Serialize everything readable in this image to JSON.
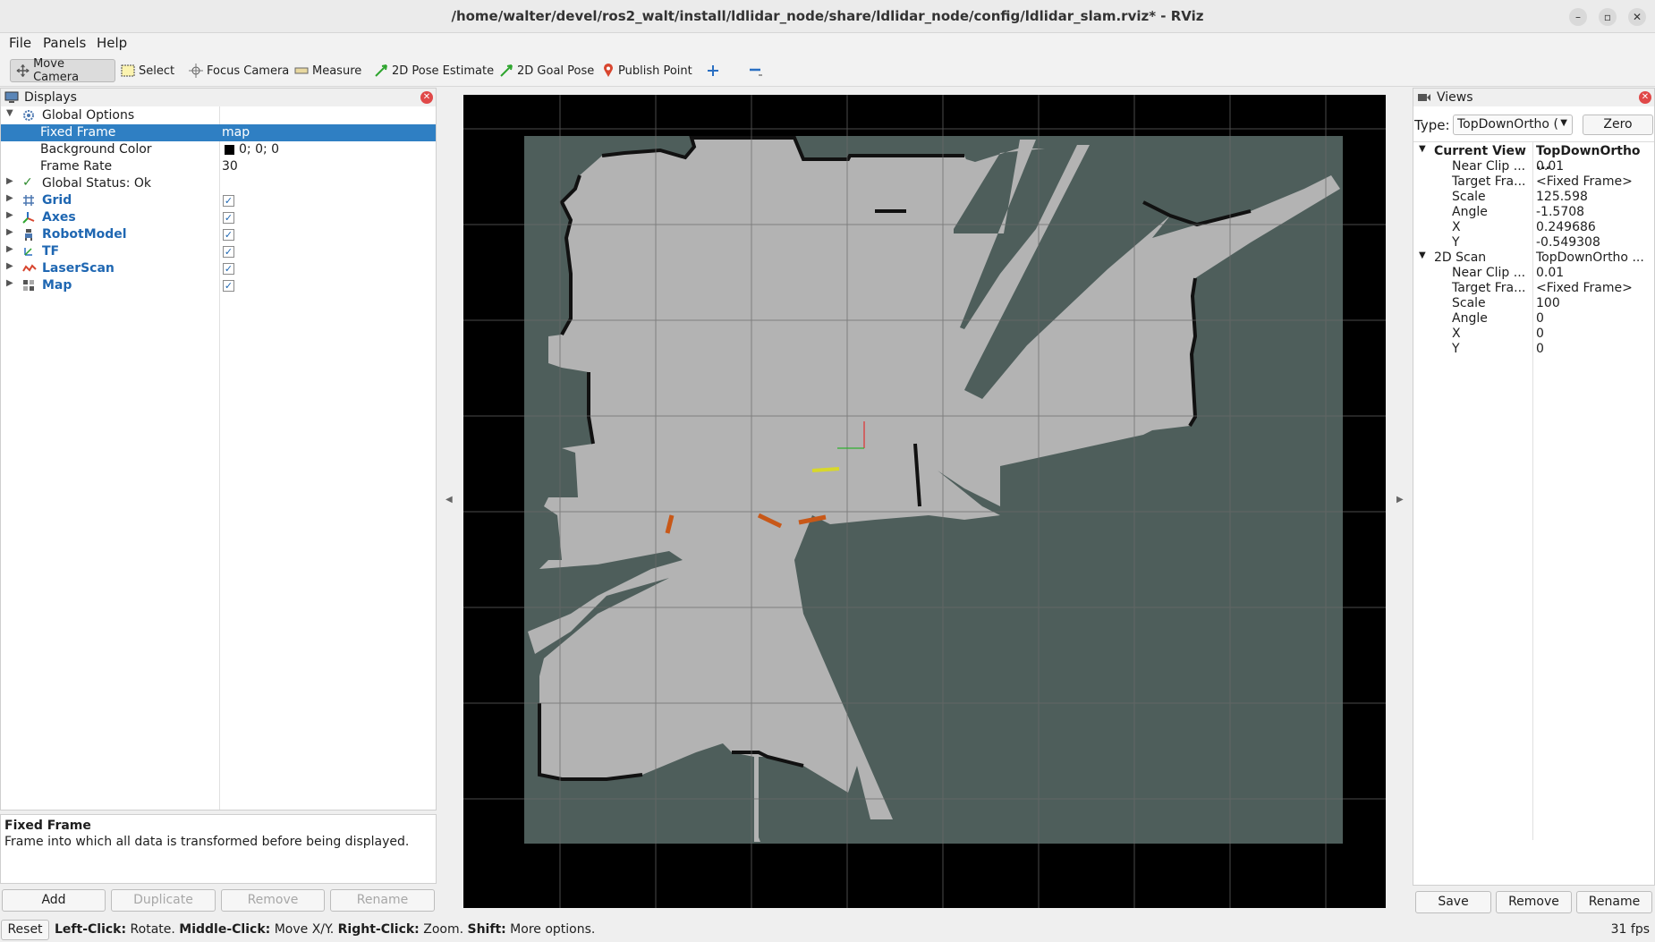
{
  "window": {
    "title": "/home/walter/devel/ros2_walt/install/ldlidar_node/share/ldlidar_node/config/ldlidar_slam.rviz* - RViz",
    "minimize": "–",
    "maximize": "▫",
    "close": "✕"
  },
  "menu": {
    "file": "File",
    "panels": "Panels",
    "help": "Help"
  },
  "toolbar": {
    "move_camera": "Move Camera",
    "select": "Select",
    "focus_camera": "Focus Camera",
    "measure": "Measure",
    "pose_estimate": "2D Pose Estimate",
    "goal_pose": "2D Goal Pose",
    "publish_point": "Publish Point"
  },
  "displays": {
    "title": "Displays",
    "global_options": "Global Options",
    "fixed_frame_label": "Fixed Frame",
    "fixed_frame_value": "map",
    "background_color_label": "Background Color",
    "background_color_value": "0; 0; 0",
    "frame_rate_label": "Frame Rate",
    "frame_rate_value": "30",
    "global_status": "Global Status: Ok",
    "items": [
      {
        "name": "Grid",
        "checked": "✓"
      },
      {
        "name": "Axes",
        "checked": "✓"
      },
      {
        "name": "RobotModel",
        "checked": "✓"
      },
      {
        "name": "TF",
        "checked": "✓"
      },
      {
        "name": "LaserScan",
        "checked": "✓"
      },
      {
        "name": "Map",
        "checked": "✓"
      }
    ],
    "help_title": "Fixed Frame",
    "help_text": "Frame into which all data is transformed before being displayed.",
    "buttons": {
      "add": "Add",
      "duplicate": "Duplicate",
      "remove": "Remove",
      "rename": "Rename"
    }
  },
  "views": {
    "title": "Views",
    "type_label": "Type:",
    "type_value": "TopDownOrtho (",
    "zero": "Zero",
    "current_view": {
      "label": "Current View",
      "value": "TopDownOrtho ...",
      "near_clip_label": "Near Clip ...",
      "near_clip": "0.01",
      "target_frame_label": "Target Fra...",
      "target_frame": "<Fixed Frame>",
      "scale_label": "Scale",
      "scale": "125.598",
      "angle_label": "Angle",
      "angle": "-1.5708",
      "x_label": "X",
      "x": "0.249686",
      "y_label": "Y",
      "y": "-0.549308"
    },
    "scan": {
      "label": "2D Scan",
      "value": "TopDownOrtho ...",
      "near_clip_label": "Near Clip ...",
      "near_clip": "0.01",
      "target_frame_label": "Target Fra...",
      "target_frame": "<Fixed Frame>",
      "scale_label": "Scale",
      "scale": "100",
      "angle_label": "Angle",
      "angle": "0",
      "x_label": "X",
      "x": "0",
      "y_label": "Y",
      "y": "0"
    },
    "buttons": {
      "save": "Save",
      "remove": "Remove",
      "rename": "Rename"
    }
  },
  "status": {
    "reset": "Reset",
    "left_click": "Left-Click:",
    "rotate": " Rotate. ",
    "middle_click": "Middle-Click:",
    "move": " Move X/Y. ",
    "right_click": "Right-Click:",
    "zoom": " Zoom. ",
    "shift": "Shift:",
    "more": " More options.",
    "fps": "31 fps"
  }
}
